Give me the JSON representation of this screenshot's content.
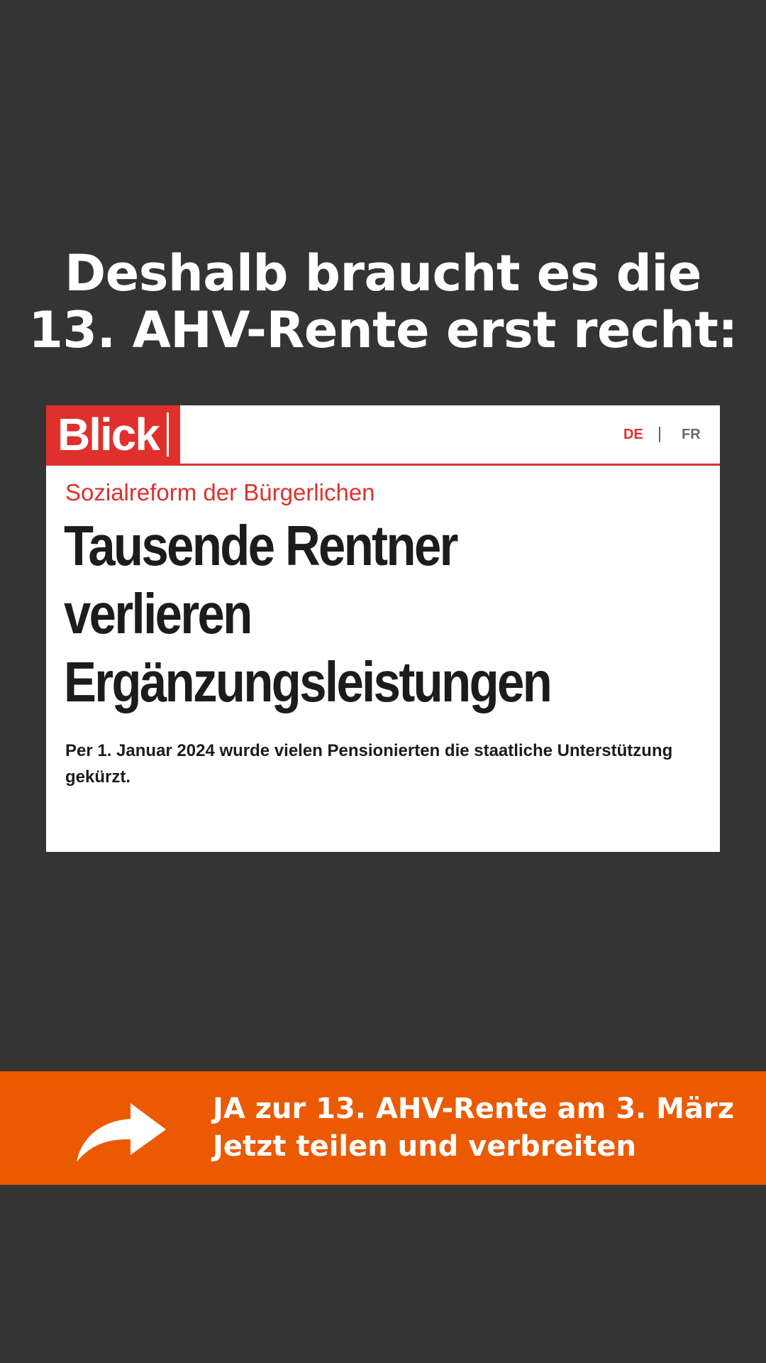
{
  "headline": {
    "line1": "Deshalb braucht es die",
    "line2": "13. AHV-Rente erst recht:"
  },
  "article": {
    "logo": "Blick",
    "languages": [
      "DE",
      "FR"
    ],
    "active_language": "DE",
    "kicker": "Sozialreform der Bürgerlichen",
    "title_lines": [
      "Tausende Rentner",
      "verlieren",
      "Ergänzungsleistungen"
    ],
    "lead": "Per 1. Januar 2024 wurde vielen Pensionierten die staatliche Unterstützung gekürzt."
  },
  "banner": {
    "icon": "share-arrow-icon",
    "line1": "JA zur 13. AHV-Rente am 3. März",
    "line2": "Jetzt teilen und verbreiten"
  },
  "colors": {
    "background": "#343434",
    "brand_red": "#e0302c",
    "banner_orange": "#eb5a00"
  }
}
